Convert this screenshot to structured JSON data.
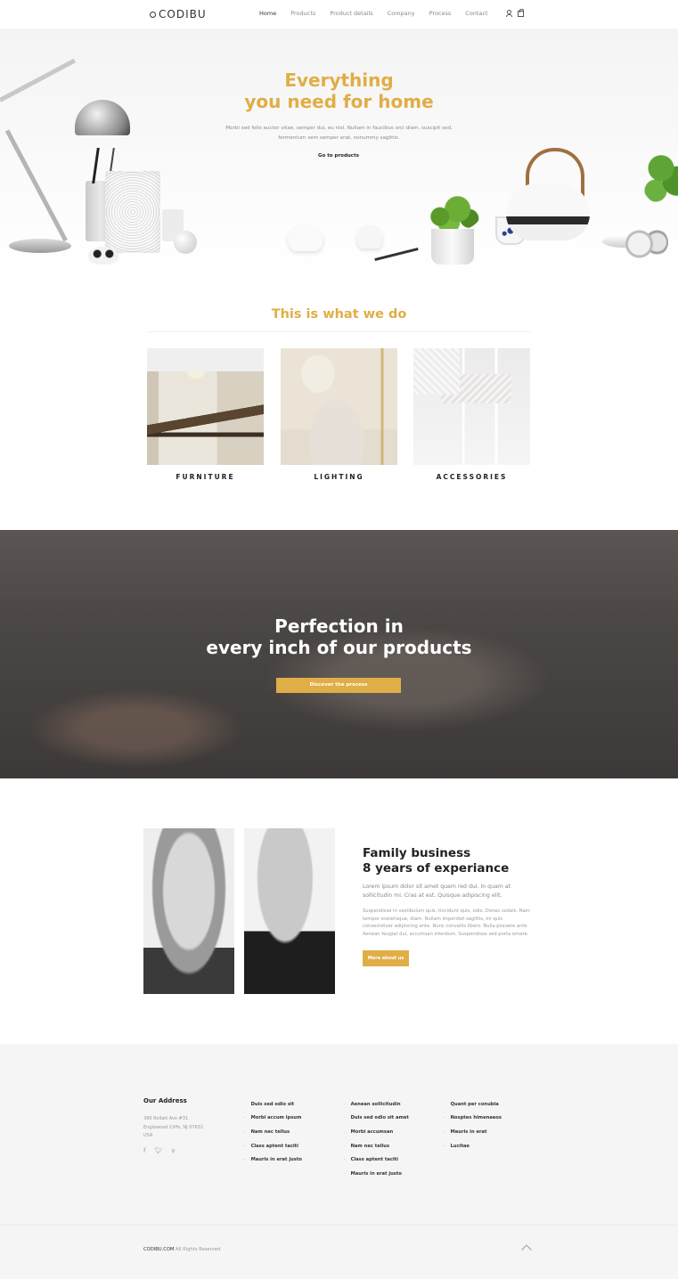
{
  "nav": {
    "logo": "CODIBU",
    "links": [
      "Home",
      "Products",
      "Product details",
      "Company",
      "Process",
      "Contact"
    ],
    "active": "Home",
    "icons": [
      "user-icon",
      "bag-icon"
    ]
  },
  "hero": {
    "title_line1": "Everything",
    "title_line2": "you need for home",
    "subtitle_line1": "Morbi sed felis auctor vitae, semper dui, eu nisl. Nullam in faucibus orci diam, suscipit sed,",
    "subtitle_line2": "fermentum sem semper erat, nonummy sagittis.",
    "cta": "Go to products"
  },
  "what_we_do": {
    "title": "This is what we do",
    "categories": [
      {
        "label": "FURNITURE"
      },
      {
        "label": "LIGHTING"
      },
      {
        "label": "ACCESSORIES"
      }
    ]
  },
  "banner": {
    "title_line1": "Perfection in",
    "title_line2": "every inch of our products",
    "cta": "Discover the process"
  },
  "family": {
    "title_line1": "Family business",
    "title_line2": "8 years of experiance",
    "lead": "Lorem ipsum dolor sit amet quam red dui. In quam at sollicitudin mi. Cras at est. Quisque adipiscing elit.",
    "body": "Suspendisse in vestibulum quis, tincidunt quis, odio. Donec sodals. Nam tempor scelerisque, diam. Nullam imperdiet sagittis, mi quis consectetuer adipiscing ante. Nunc convallis libero. Nulla posuere ante. Aenean feugiat dui, accumsan interdum. Suspendisse sed porta ornare.",
    "cta": "More about us"
  },
  "footer": {
    "address_title": "Our Address",
    "address_lines": [
      "386 Rollatt Ave #31",
      "Englewood Cliffs, NJ 07632",
      "USA"
    ],
    "social_icons": [
      "facebook-icon",
      "twitter-icon",
      "vimeo-icon"
    ],
    "col1": [
      "Duis sed odio sit",
      "Morbi accum ipsum",
      "Nam nec tellus",
      "Class aptent taciti",
      "Mauris in erat justo"
    ],
    "col2": [
      "Aenean sollicitudin",
      "Duis sed odio sit amet",
      "Morbi accumsan",
      "Nam nec tellus",
      "Class aptent taciti",
      "Mauris in erat justo"
    ],
    "col3": [
      "Quant per conubia",
      "Nosptes himenaeos",
      "Mauris in erat",
      "Lucitae"
    ],
    "copyright_brand": "CODIBU.COM",
    "copyright_rest": " All Rights Reserved"
  },
  "colors": {
    "accent": "#e0ae46",
    "dark": "#222222",
    "muted": "#999999"
  }
}
